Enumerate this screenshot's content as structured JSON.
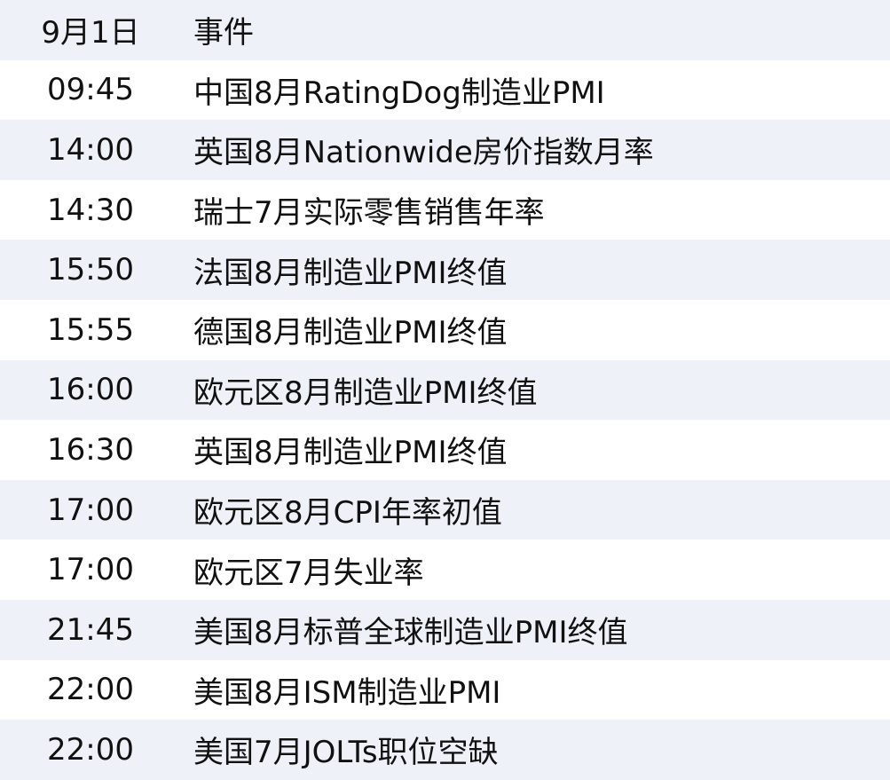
{
  "header": {
    "date": "9月1日",
    "event": "事件"
  },
  "rows": [
    {
      "time": "09:45",
      "event": "中国8月RatingDog制造业PMI"
    },
    {
      "time": "14:00",
      "event": "英国8月Nationwide房价指数月率"
    },
    {
      "time": "14:30",
      "event": "瑞士7月实际零售销售年率"
    },
    {
      "time": "15:50",
      "event": "法国8月制造业PMI终值"
    },
    {
      "time": "15:55",
      "event": "德国8月制造业PMI终值"
    },
    {
      "time": "16:00",
      "event": "欧元区8月制造业PMI终值"
    },
    {
      "time": "16:30",
      "event": "英国8月制造业PMI终值"
    },
    {
      "time": "17:00",
      "event": "欧元区8月CPI年率初值"
    },
    {
      "time": "17:00",
      "event": "欧元区7月失业率"
    },
    {
      "time": "21:45",
      "event": "美国8月标普全球制造业PMI终值"
    },
    {
      "time": "22:00",
      "event": "美国8月ISM制造业PMI"
    },
    {
      "time": "22:00",
      "event": "美国7月JOLTs职位空缺"
    }
  ],
  "colors": {
    "stripe": "#eef1f8",
    "text": "#111111"
  }
}
